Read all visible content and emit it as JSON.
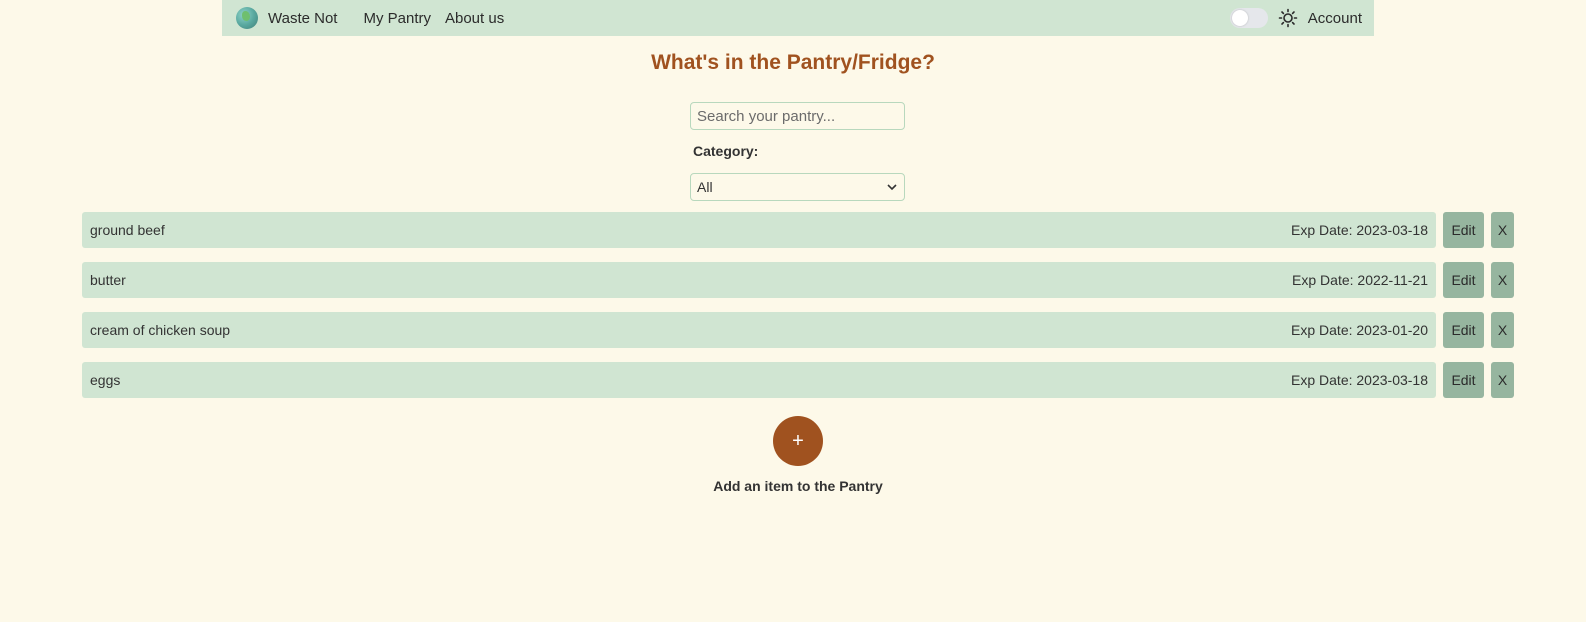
{
  "nav": {
    "brand": "Waste Not",
    "links": [
      "My Pantry",
      "About us"
    ],
    "account": "Account",
    "logo_icon": "globe-icon",
    "theme_icon": "sun-icon"
  },
  "page": {
    "title": "What's in the Pantry/Fridge?"
  },
  "search": {
    "placeholder": "Search your pantry...",
    "value": ""
  },
  "category": {
    "label": "Category:",
    "selected": "All"
  },
  "items": [
    {
      "name": "ground beef",
      "exp": "Exp Date: 2023-03-18",
      "edit": "Edit",
      "delete": "X"
    },
    {
      "name": "butter",
      "exp": "Exp Date: 2022-11-21",
      "edit": "Edit",
      "delete": "X"
    },
    {
      "name": "cream of chicken soup",
      "exp": "Exp Date: 2023-01-20",
      "edit": "Edit",
      "delete": "X"
    },
    {
      "name": "eggs",
      "exp": "Exp Date: 2023-03-18",
      "edit": "Edit",
      "delete": "X"
    }
  ],
  "add": {
    "icon_label": "+",
    "label": "Add an item to the Pantry"
  },
  "colors": {
    "background": "#fdf9e9",
    "navbar": "#d0e5d2",
    "accent": "#a0521f",
    "item_bg": "#d0e5d2",
    "button_bg": "#96b59f"
  }
}
